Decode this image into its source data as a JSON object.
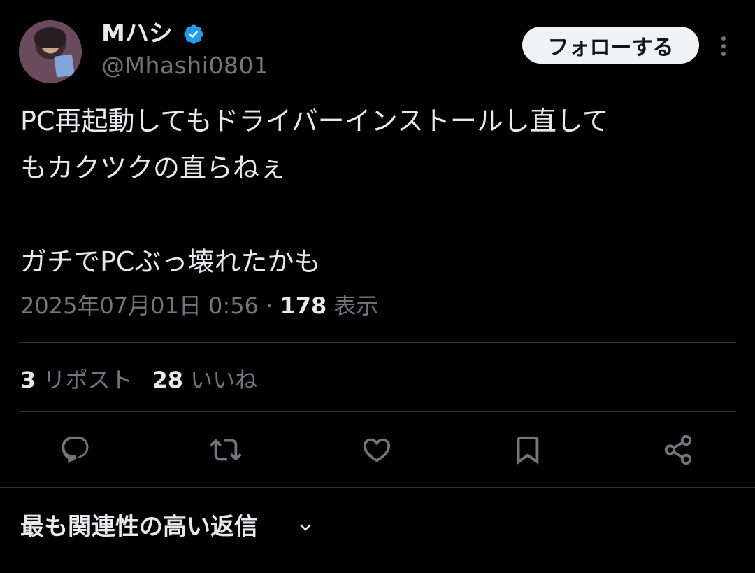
{
  "author": {
    "display_name": "Mハシ",
    "handle": "@Mhashi0801",
    "verified_icon": "verified-badge-icon",
    "verified_color": "#1d9bf0"
  },
  "follow_button_label": "フォローする",
  "tweet": {
    "text": "PC再起動してもドライバーインストールし直して\nもカクツクの直らねぇ\n\nガチでPCぶっ壊れたかも",
    "date": "2025年07月01日 0:56",
    "separator": " · ",
    "views_count": "178",
    "views_label": " 表示"
  },
  "stats": {
    "reposts_count": "3",
    "reposts_label": " リポスト",
    "likes_count": "28",
    "likes_label": " いいね"
  },
  "actions": [
    "reply-icon",
    "repost-icon",
    "like-icon",
    "bookmark-icon",
    "share-icon"
  ],
  "replies_sort_label": "最も関連性の高い返信",
  "colors": {
    "background": "#000000",
    "text": "#e7e9ea",
    "secondary": "#71767b",
    "divider": "#2f3336",
    "button_bg": "#eff3f4"
  }
}
